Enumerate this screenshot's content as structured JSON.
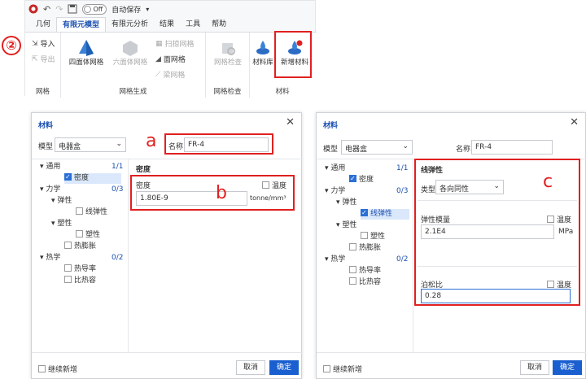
{
  "ribbon": {
    "autosave_toggle": "Off",
    "autosave_label": "自动保存",
    "tabs": [
      "几何",
      "有限元模型",
      "有限元分析",
      "结果",
      "工具",
      "帮助"
    ],
    "active_tab": "有限元模型",
    "step_marker": "②",
    "groups": {
      "mesh": {
        "import": "导入",
        "export": "导出",
        "label": "网格"
      },
      "mesh_gen": {
        "tetra": "四面体网格",
        "hexa": "六面体网格",
        "sweep": "扫掠网格",
        "face": "面网格",
        "beam": "梁网格",
        "label": "网格生成"
      },
      "mesh_check": {
        "check": "网格检查",
        "label": "网格检查"
      },
      "material": {
        "library": "材料库",
        "new": "新增材料",
        "label": "材料"
      }
    }
  },
  "dialog_left": {
    "title": "材料",
    "model_label": "模型",
    "model_value": "电器盒",
    "name_label": "名称",
    "name_value": "FR-4",
    "tree": {
      "general": "通用",
      "general_count": "1/1",
      "density": "密度",
      "mechanics": "力学",
      "mechanics_count": "0/3",
      "elastic": "弹性",
      "linear_elastic": "线弹性",
      "plastic": "塑性",
      "plastic_item": "塑性",
      "thermal_exp": "热膨胀",
      "thermal": "热学",
      "thermal_count": "0/2",
      "conductivity": "热导率",
      "specific_heat": "比热容"
    },
    "section_title": "密度",
    "density_label": "密度",
    "temp_label": "温度",
    "density_value": "1.80E-9",
    "density_unit": "tonne/mm³",
    "continue_label": "继续新增",
    "cancel": "取消",
    "ok": "确定",
    "marker_a": "a",
    "marker_b": "b"
  },
  "dialog_right": {
    "title": "材料",
    "model_label": "模型",
    "model_value": "电器盒",
    "name_label": "名称",
    "name_value": "FR-4",
    "section_title": "线弹性",
    "type_label": "类型",
    "type_value": "各向同性",
    "modulus_label": "弹性模量",
    "temp_label": "温度",
    "modulus_value": "2.1E4",
    "modulus_unit": "MPa",
    "poisson_label": "泊松比",
    "poisson_temp_label": "温度",
    "poisson_value": "0.28",
    "continue_label": "继续新增",
    "cancel": "取消",
    "ok": "确定",
    "marker_c": "c"
  }
}
